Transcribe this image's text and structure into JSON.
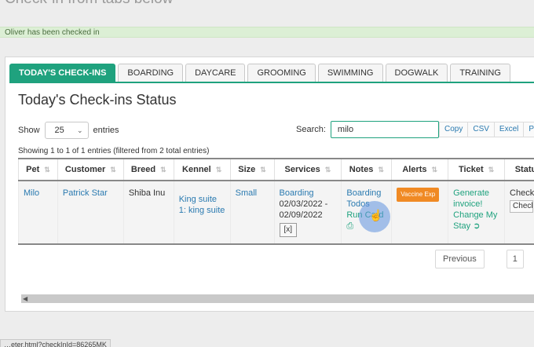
{
  "page": {
    "heading": "Check-in from tabs below",
    "alert": "Oliver has been checked in"
  },
  "tabs": [
    {
      "label": "TODAY'S CHECK-INS",
      "active": true
    },
    {
      "label": "BOARDING",
      "active": false
    },
    {
      "label": "DAYCARE",
      "active": false
    },
    {
      "label": "GROOMING",
      "active": false
    },
    {
      "label": "SWIMMING",
      "active": false
    },
    {
      "label": "DOGWALK",
      "active": false
    },
    {
      "label": "TRAINING",
      "active": false
    }
  ],
  "panel": {
    "title": "Today's Check-ins Status",
    "show_label": "Show",
    "page_size": "25",
    "entries_label": "entries",
    "search_label": "Search:",
    "search_value": "milo",
    "export_buttons": [
      "Copy",
      "CSV",
      "Excel",
      "PDF"
    ],
    "info": "Showing 1 to 1 of 1 entries (filtered from 2 total entries)"
  },
  "table": {
    "columns": [
      "Pet",
      "Customer",
      "Breed",
      "Kennel",
      "Size",
      "Services",
      "Notes",
      "Alerts",
      "Ticket",
      "Status"
    ],
    "row": {
      "pet": "Milo",
      "customer": "Patrick Star",
      "breed": "Shiba Inu",
      "kennel": "King suite 1: king suite",
      "size": "Small",
      "service_name": "Boarding",
      "service_dates": "02/03/2022 - 02/09/2022",
      "service_remove": "[x]",
      "notes_line1": "Boarding",
      "notes_line2": "Todos",
      "notes_line3": "Run Card",
      "alert_badge": "Vaccine Exp",
      "ticket_generate": "Generate invoice!",
      "ticket_change": "Change My Stay",
      "status_text": "Check",
      "status_btn": "Check"
    }
  },
  "pagination": {
    "previous": "Previous",
    "page": "1"
  },
  "status_url": "…eter.html?checkInId=86265MK",
  "colors": {
    "accent": "#1fa27e",
    "link": "#2a7ab0",
    "alert_badge": "#f08a24",
    "success_bg": "#dcefd5"
  }
}
